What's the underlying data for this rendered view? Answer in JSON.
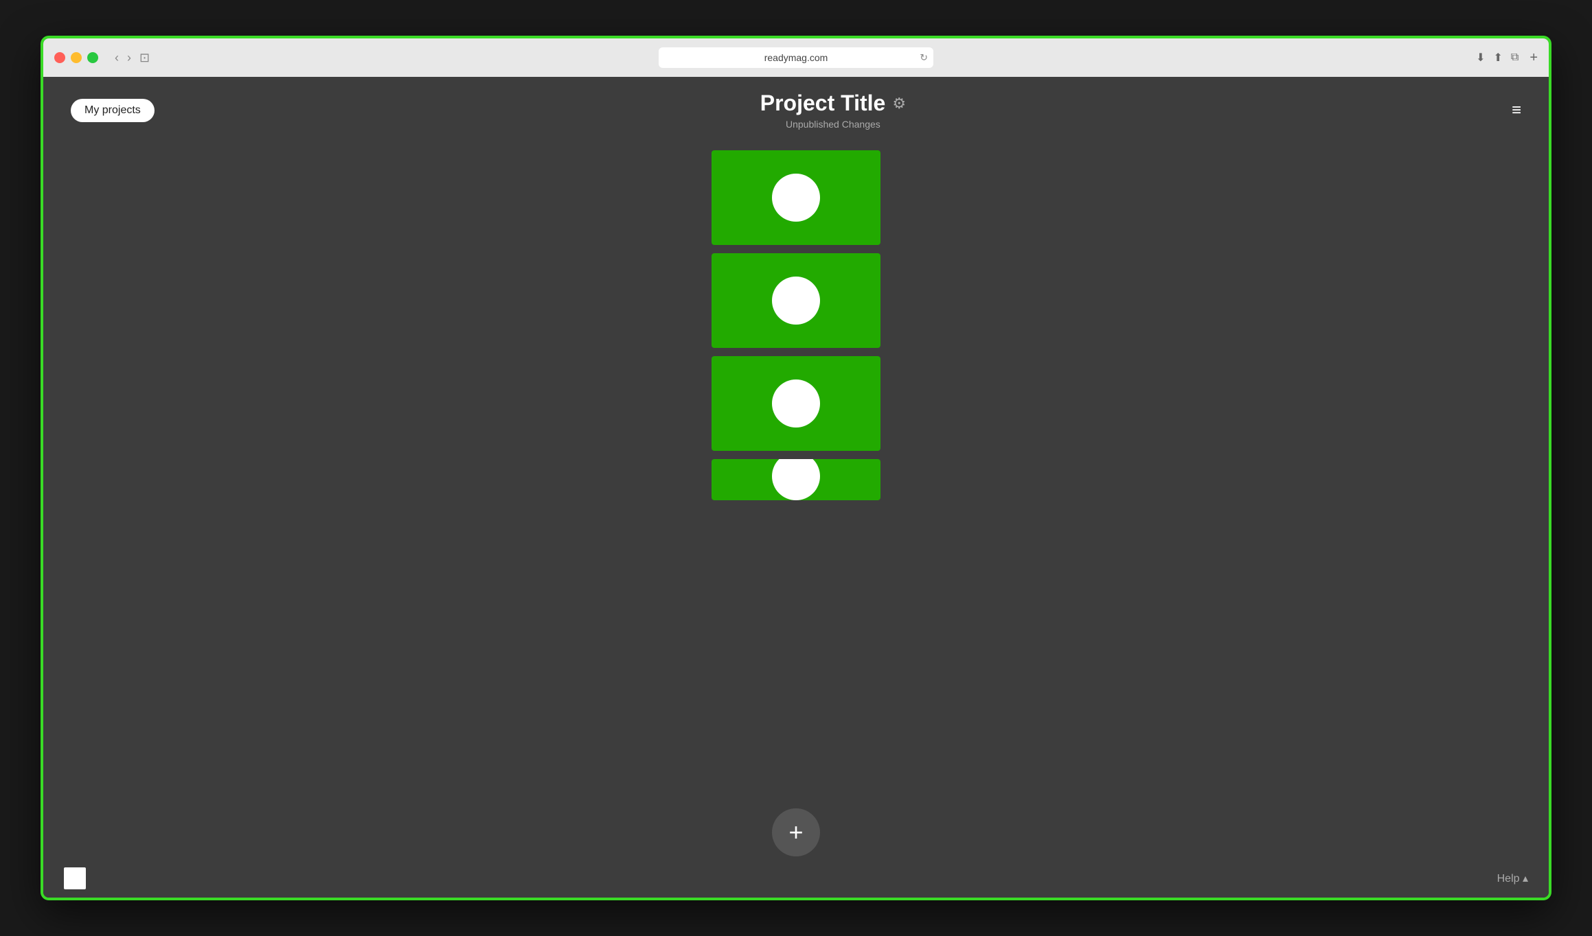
{
  "browser": {
    "url": "readymag.com",
    "reload_icon": "↻"
  },
  "header": {
    "my_projects_label": "My projects",
    "project_title": "Project Title",
    "settings_icon": "⚙",
    "unpublished_label": "Unpublished Changes",
    "hamburger_icon": "≡"
  },
  "slides": [
    {
      "id": 1
    },
    {
      "id": 2
    },
    {
      "id": 3
    },
    {
      "id": 4,
      "partial": true
    }
  ],
  "add_button": {
    "label": "+",
    "icon": "plus-icon"
  },
  "bottom_bar": {
    "help_label": "Help ▴"
  },
  "colors": {
    "slide_bg": "#22aa00",
    "circle_fill": "#ffffff",
    "app_bg": "#3d3d3d",
    "border": "#3adb26"
  }
}
